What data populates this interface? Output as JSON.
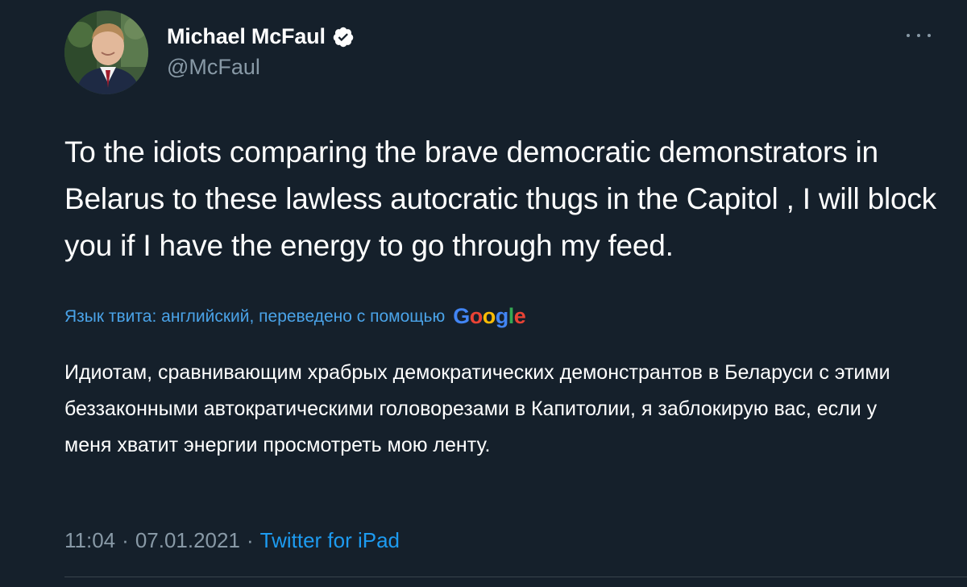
{
  "author": {
    "name": "Michael McFaul",
    "handle": "@McFaul",
    "verified": true
  },
  "tweet": {
    "text": "To the idiots comparing the brave democratic demonstrators in Belarus to these lawless autocratic thugs in the Capitol , I will block you if I have the energy to go through my feed."
  },
  "translation": {
    "label": "Язык твита: английский, переведено с помощью",
    "provider_letters": [
      "G",
      "o",
      "o",
      "g",
      "l",
      "e"
    ],
    "provider_colors": [
      "#4285f4",
      "#ea4335",
      "#fbbc05",
      "#4285f4",
      "#34a853",
      "#ea4335"
    ],
    "text": "Идиотам, сравнивающим храбрых демократических демонстрантов в Беларуси с этими беззаконными автократическими головорезами в Капитолии, я заблокирую вас, если у меня хватит энергии просмотреть мою ленту."
  },
  "meta": {
    "time": "11:04",
    "separator": "·",
    "date": "07.01.2021",
    "source": "Twitter for iPad"
  },
  "colors": {
    "background": "#15202b",
    "secondary_text": "#8899a6",
    "link": "#1d9bf0",
    "verified": "#ffffff"
  },
  "icons": {
    "verified": "verified-badge-icon",
    "more": "more-horizontal-icon"
  }
}
